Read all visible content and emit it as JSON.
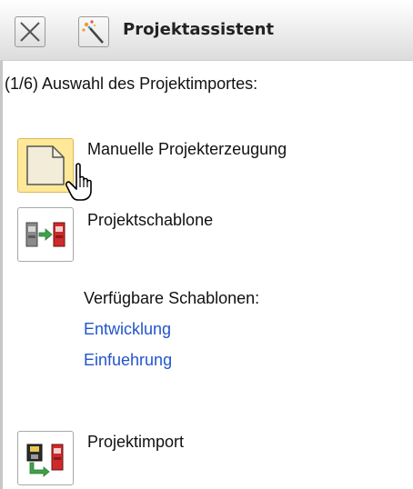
{
  "window": {
    "title": "Projektassistent",
    "close_icon": "close-icon",
    "app_icon": "wizard-wand-icon"
  },
  "wizard": {
    "step_text": "(1/6) Auswahl des Projektimportes:"
  },
  "options": [
    {
      "label": "Manuelle Projekterzeugung",
      "icon": "blank-document-icon",
      "hovered": true
    },
    {
      "label": "Projektschablone",
      "icon": "template-transfer-icon",
      "hovered": false
    },
    {
      "label": "Projektimport",
      "icon": "project-import-icon",
      "hovered": false
    }
  ],
  "templates": {
    "label": "Verfügbare Schablonen:",
    "items": [
      "Entwicklung",
      "Einfuehrung"
    ]
  },
  "colors": {
    "link": "#2255cc",
    "hover_bg": "#ffe897"
  }
}
